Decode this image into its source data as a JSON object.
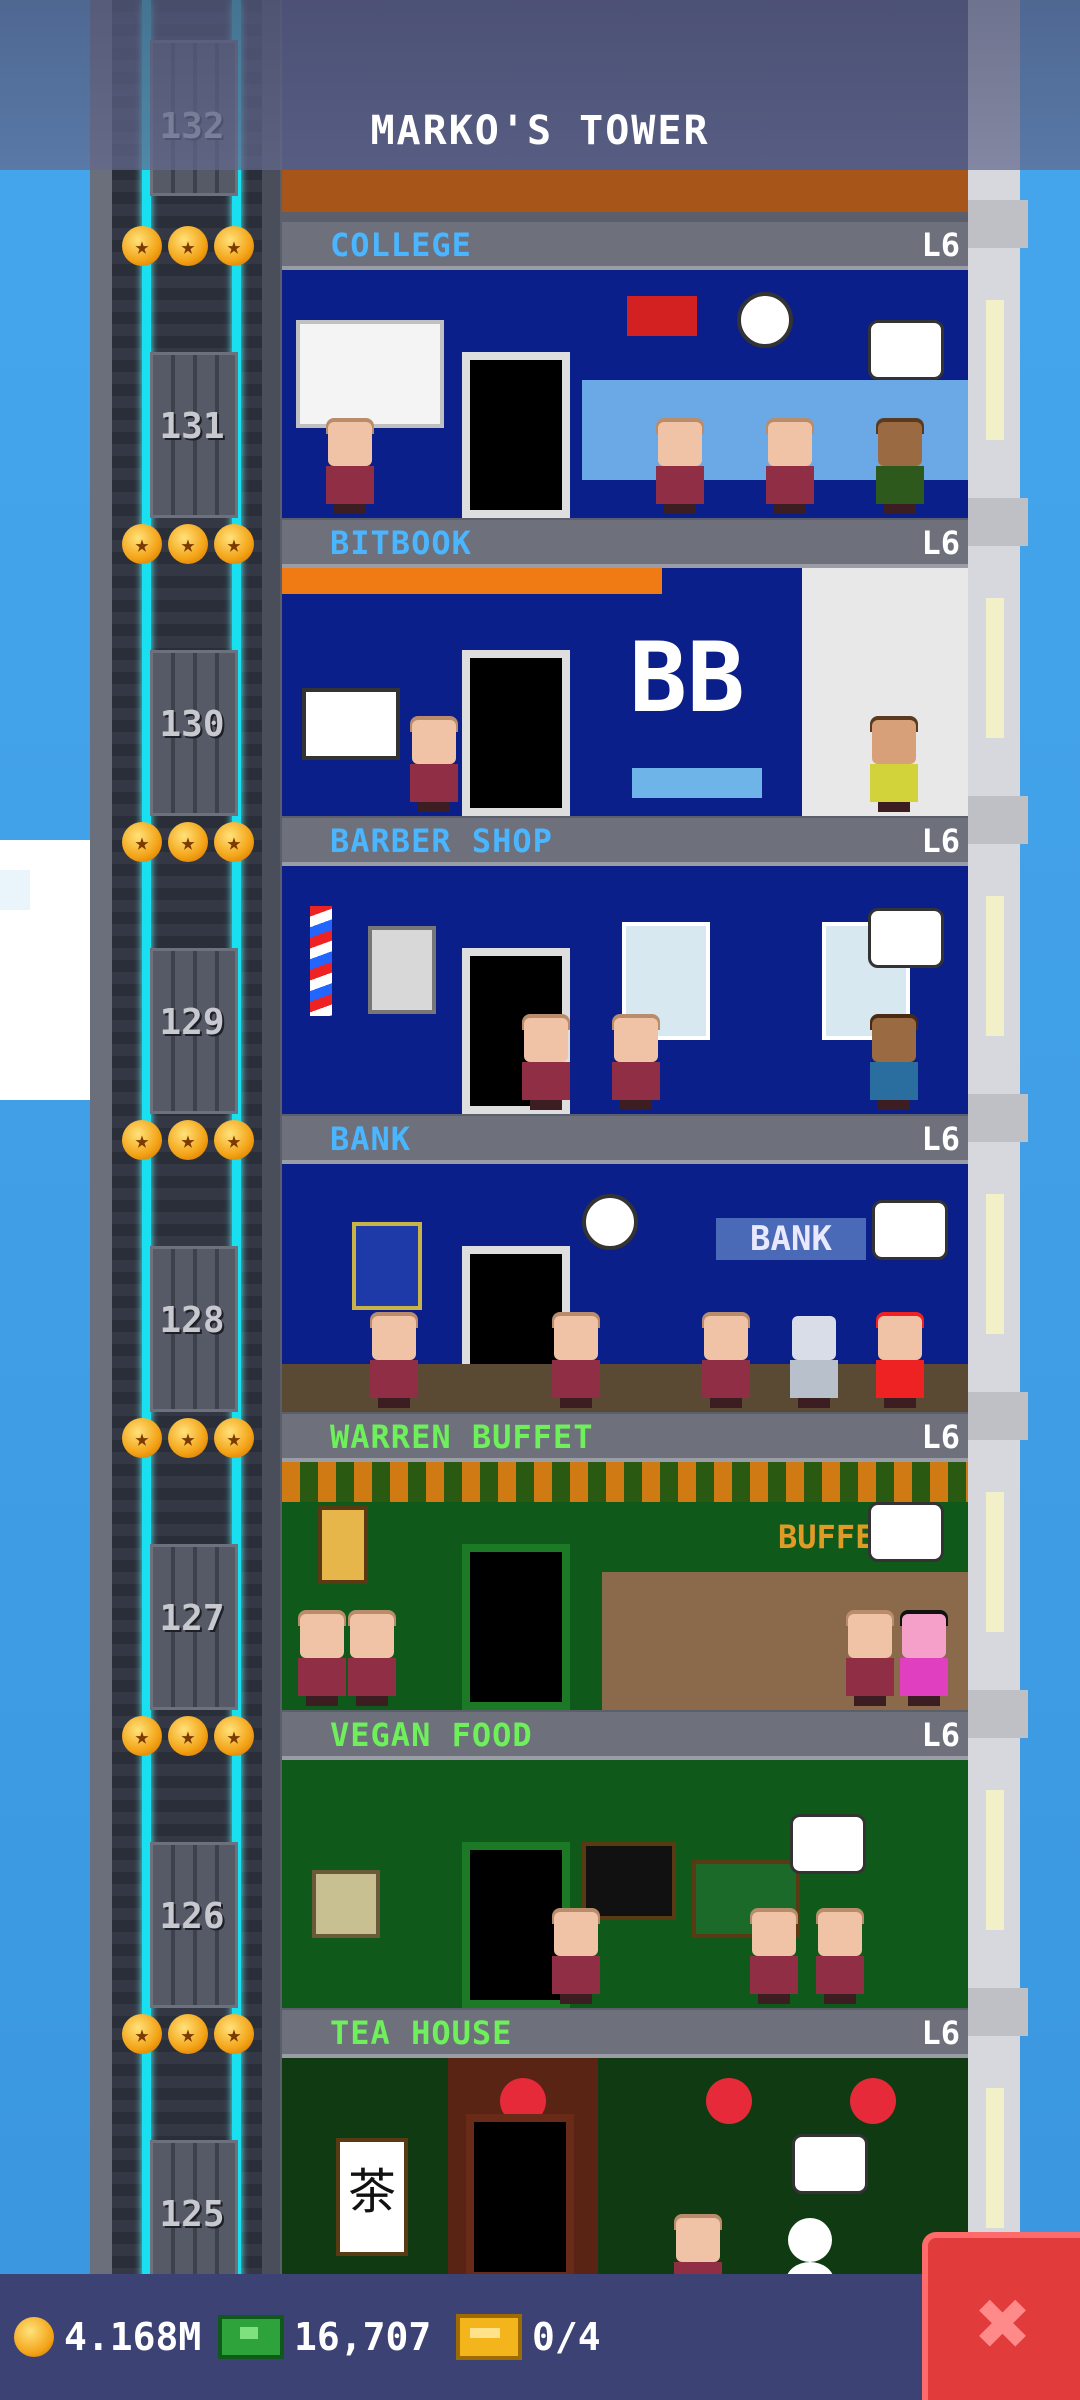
{
  "tower": {
    "title": "MARKO'S TOWER"
  },
  "top_floor_number": "132",
  "floors": [
    {
      "number": "131",
      "name": "COLLEGE",
      "level": "L6",
      "name_color": "#4ab6ff",
      "room_color": "#0b1f8a"
    },
    {
      "number": "130",
      "name": "BITBOOK",
      "level": "L6",
      "name_color": "#4ab6ff",
      "room_color": "#0b1f8a"
    },
    {
      "number": "129",
      "name": "BARBER SHOP",
      "level": "L6",
      "name_color": "#4ab6ff",
      "room_color": "#0b1f8a"
    },
    {
      "number": "128",
      "name": "BANK",
      "level": "L6",
      "name_color": "#4ab6ff",
      "room_color": "#0b1f8a"
    },
    {
      "number": "127",
      "name": "WARREN BUFFET",
      "level": "L6",
      "name_color": "#6ef05a",
      "room_color": "#0f5a1b"
    },
    {
      "number": "126",
      "name": "VEGAN FOOD",
      "level": "L6",
      "name_color": "#6ef05a",
      "room_color": "#0f5a1b"
    },
    {
      "number": "125",
      "name": "TEA HOUSE",
      "level": "L6",
      "name_color": "#6ef05a",
      "room_color": "#0f3a12"
    }
  ],
  "room_signs": {
    "bitbook": "BB",
    "bank": "BANK",
    "buffet": "BUFFET",
    "tea": "茶"
  },
  "resources": {
    "coins": "4.168M",
    "bux": "16,707",
    "tickets": "0/4"
  },
  "icons": {
    "star": "star-icon",
    "coin": "coin-icon",
    "bux": "bux-icon",
    "ticket": "ticket-icon",
    "close": "close-icon"
  },
  "close_symbol": "✖",
  "star_symbol": "★"
}
